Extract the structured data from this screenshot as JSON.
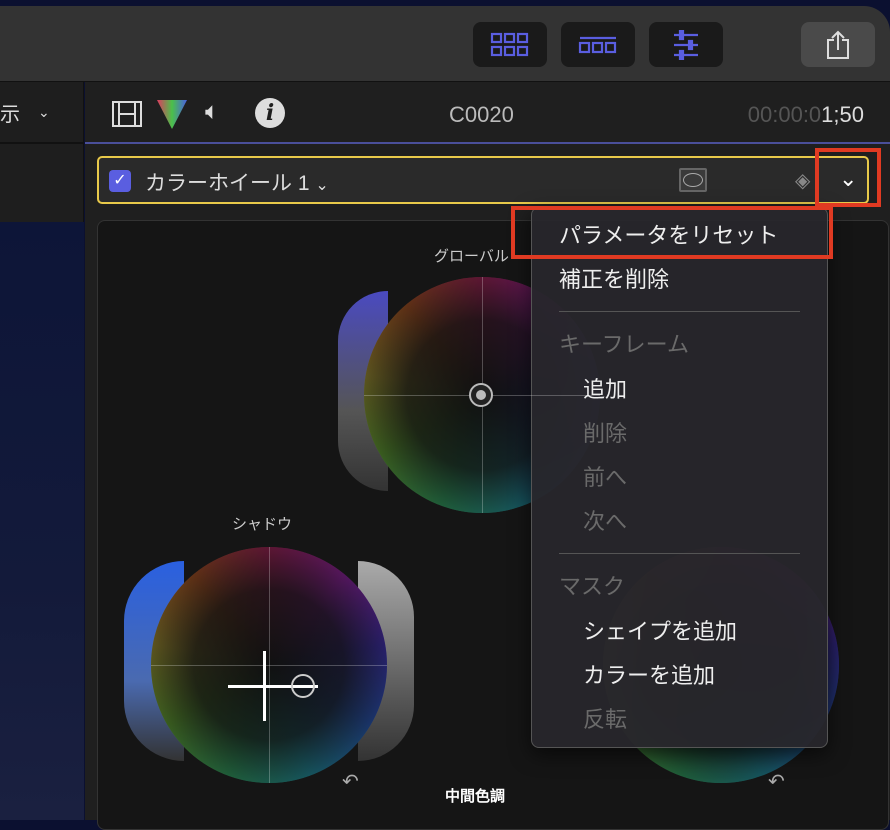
{
  "toolbar": {
    "buttons": [
      "browser-grid",
      "timeline",
      "inspector"
    ],
    "share": "share"
  },
  "left_pane": {
    "label": "示"
  },
  "inspector": {
    "clip_name": "C0020",
    "timecode_dim": "00:00:0",
    "timecode_bright": "1;50",
    "effect": {
      "enabled": true,
      "name": "カラーホイール 1"
    }
  },
  "wheels": {
    "global": "グローバル",
    "shadow": "シャドウ",
    "midtone": "中間色調"
  },
  "menu": {
    "reset": "パラメータをリセット",
    "delete": "補正を削除",
    "keyframe_header": "キーフレーム",
    "add": "追加",
    "remove": "削除",
    "prev": "前へ",
    "next": "次へ",
    "mask_header": "マスク",
    "add_shape": "シェイプを追加",
    "add_color": "カラーを追加",
    "invert": "反転"
  },
  "colors": {
    "accent": "#5a5ee0",
    "highlight": "#e03a22",
    "effect_border": "#e8c94a"
  }
}
